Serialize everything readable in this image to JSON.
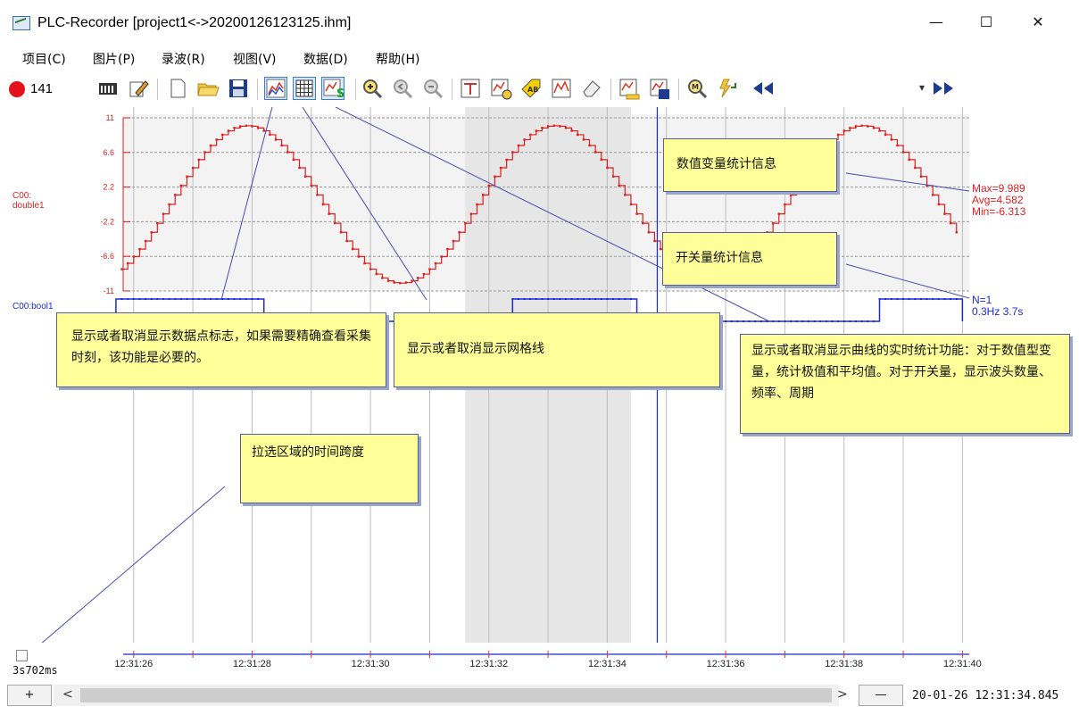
{
  "window": {
    "title": "PLC-Recorder  [project1<->20200126123125.ihm]",
    "minimize": "—",
    "maximize": "☐",
    "close": "✕"
  },
  "menu": [
    "项目(C)",
    "图片(P)",
    "录波(R)",
    "视图(V)",
    "数据(D)",
    "帮助(H)"
  ],
  "toolbar": {
    "record_count": "141",
    "record_color": "#e3121b",
    "buttons": [
      "panel-icon",
      "edit-icon",
      "new-file-icon",
      "open-folder-icon",
      "save-icon",
      "data-markers-icon",
      "grid-icon",
      "statistics-icon",
      "zoom-in-icon",
      "zoom-prev-icon",
      "zoom-out-icon",
      "cursor-icon",
      "measure-icon",
      "annotate-icon",
      "chart-icon",
      "eraser-icon",
      "import-icon",
      "export-icon",
      "search-icon",
      "refresh-icon",
      "rewind-icon",
      "fast-forward-icon"
    ],
    "combo_value": ""
  },
  "chart_data": {
    "type": "line",
    "series": [
      {
        "name": "C00:\ndouble1",
        "color": "#e01e1e",
        "kind": "analog",
        "period_s": 5.2,
        "phase_s": 27.9,
        "ylim": [
          -11,
          11
        ],
        "yticks": [
          "11",
          "6.6",
          "2.2",
          "-2.2",
          "-6.6",
          "-11"
        ]
      },
      {
        "name": "C00:bool1",
        "color": "#1a2bd6",
        "kind": "digital"
      }
    ],
    "x_ticks": [
      "12:31:26",
      "12:31:28",
      "12:31:30",
      "12:31:32",
      "12:31:34",
      "12:31:36",
      "12:31:38",
      "12:31:40"
    ],
    "x_range": [
      25.4,
      40.1
    ],
    "bool_high": [
      [
        25.7,
        28.2
      ],
      [
        32.4,
        34.5
      ],
      [
        38.6,
        40.0
      ]
    ],
    "selection": [
      31.6,
      34.4
    ],
    "cursor_time": 34.845,
    "analog_stats": {
      "max": "Max=9.989",
      "avg": "Avg=4.582",
      "min": "Min=-6.313"
    },
    "bool_stats": {
      "count": "N=1",
      "freq": "0.3Hz 3.7s"
    }
  },
  "callouts": {
    "numeric_stats": "数值变量统计信息",
    "switch_stats": "开关量统计信息",
    "markers": "显示或者取消显示数据点标志，如果需要精确查看采集时刻，该功能是必要的。",
    "grid": "显示或者取消显示网格线",
    "realtime_stats": "显示或者取消显示曲线的实时统计功能：对于数值型变量，统计极值和平均值。对于开关量，显示波头数量、频率、周期",
    "span": "拉选区域的时间跨度"
  },
  "bottom": {
    "span_value": "3s702ms",
    "plus": "+",
    "minus": "—",
    "left_arrow": "<",
    "right_arrow": ">",
    "datetime": "20-01-26 12:31:34.845"
  }
}
